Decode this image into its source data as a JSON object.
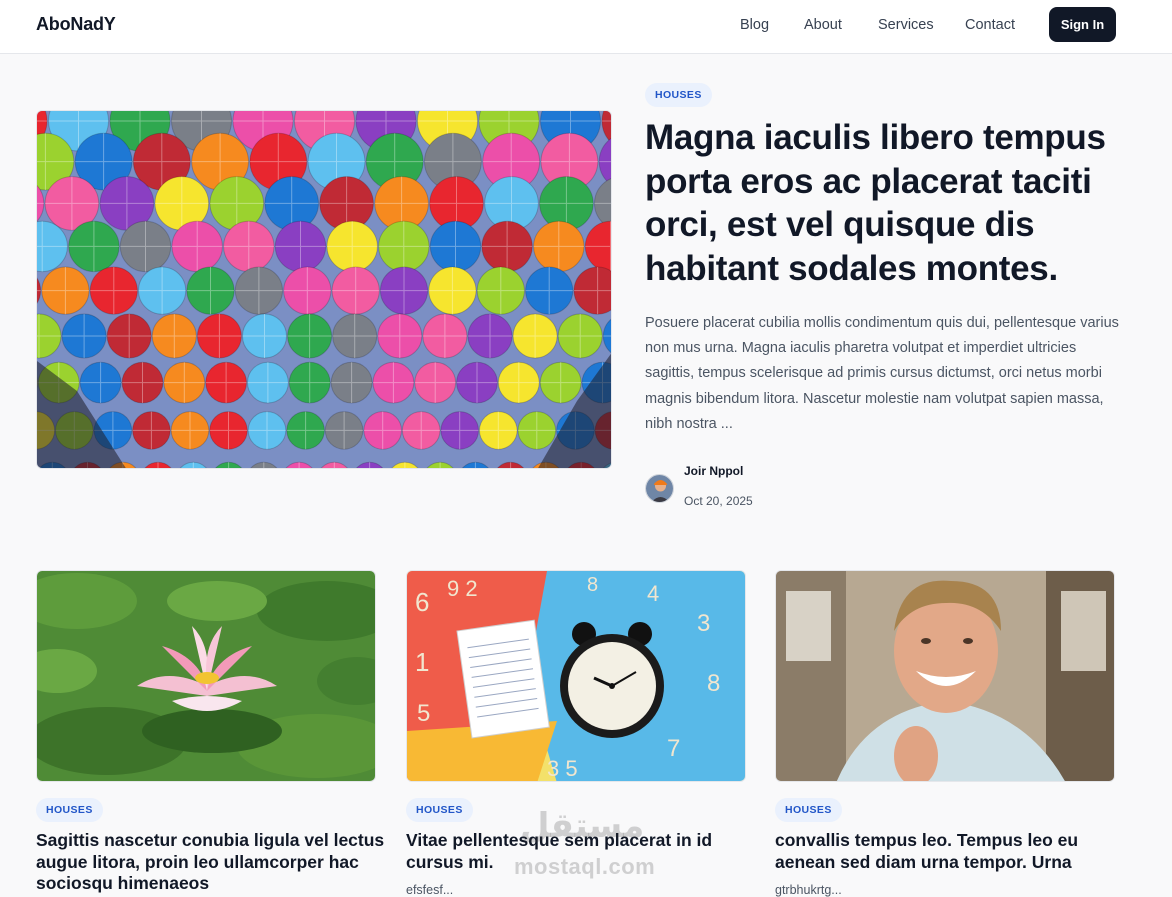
{
  "header": {
    "brand": "AboNadY",
    "nav": [
      "Blog",
      "About",
      "Services",
      "Contact"
    ],
    "signin_label": "Sign In"
  },
  "hero": {
    "category": "HOUSES",
    "title": "Magna iaculis libero tempus porta eros ac placerat taciti orci, est vel quisque dis habitant sodales montes.",
    "excerpt": "Posuere placerat cubilia mollis condimentum quis dui, pellentesque varius non mus urna. Magna iaculis pharetra volutpat et imperdiet ultricies sagittis, tempus scelerisque ad primis cursus dictumst, orci netus morbi magnis bibendum litora. Nascetur molestie nam volutpat sapien massa, nibh nostra ...",
    "author": "Joir Nppol",
    "date": "Oct 20, 2025",
    "image": "umbrellas-photo"
  },
  "cards": [
    {
      "category": "HOUSES",
      "title": "Sagittis nascetur conubia ligula vel lectus augue litora, proin leo ullamcorper hac sociosqu himenaeos",
      "excerpt": "",
      "image": "water-lily-photo"
    },
    {
      "category": "HOUSES",
      "title": "Vitae pellentesque sem placerat in id cursus mi.",
      "excerpt": "efsfesf...",
      "image": "alarm-clock-notebook-photo"
    },
    {
      "category": "HOUSES",
      "title": "convallis tempus leo. Tempus leo eu aenean sed diam urna tempor. Urna",
      "excerpt": "gtrbhukrtg...",
      "image": "smiling-man-photo"
    }
  ],
  "watermark": {
    "arabic": "مستقل",
    "latin": "mostaql.com"
  },
  "colors": {
    "accent": "#111827",
    "badge_bg": "#eaf1fd",
    "badge_text": "#2256c8",
    "background": "#f9f9fa"
  }
}
